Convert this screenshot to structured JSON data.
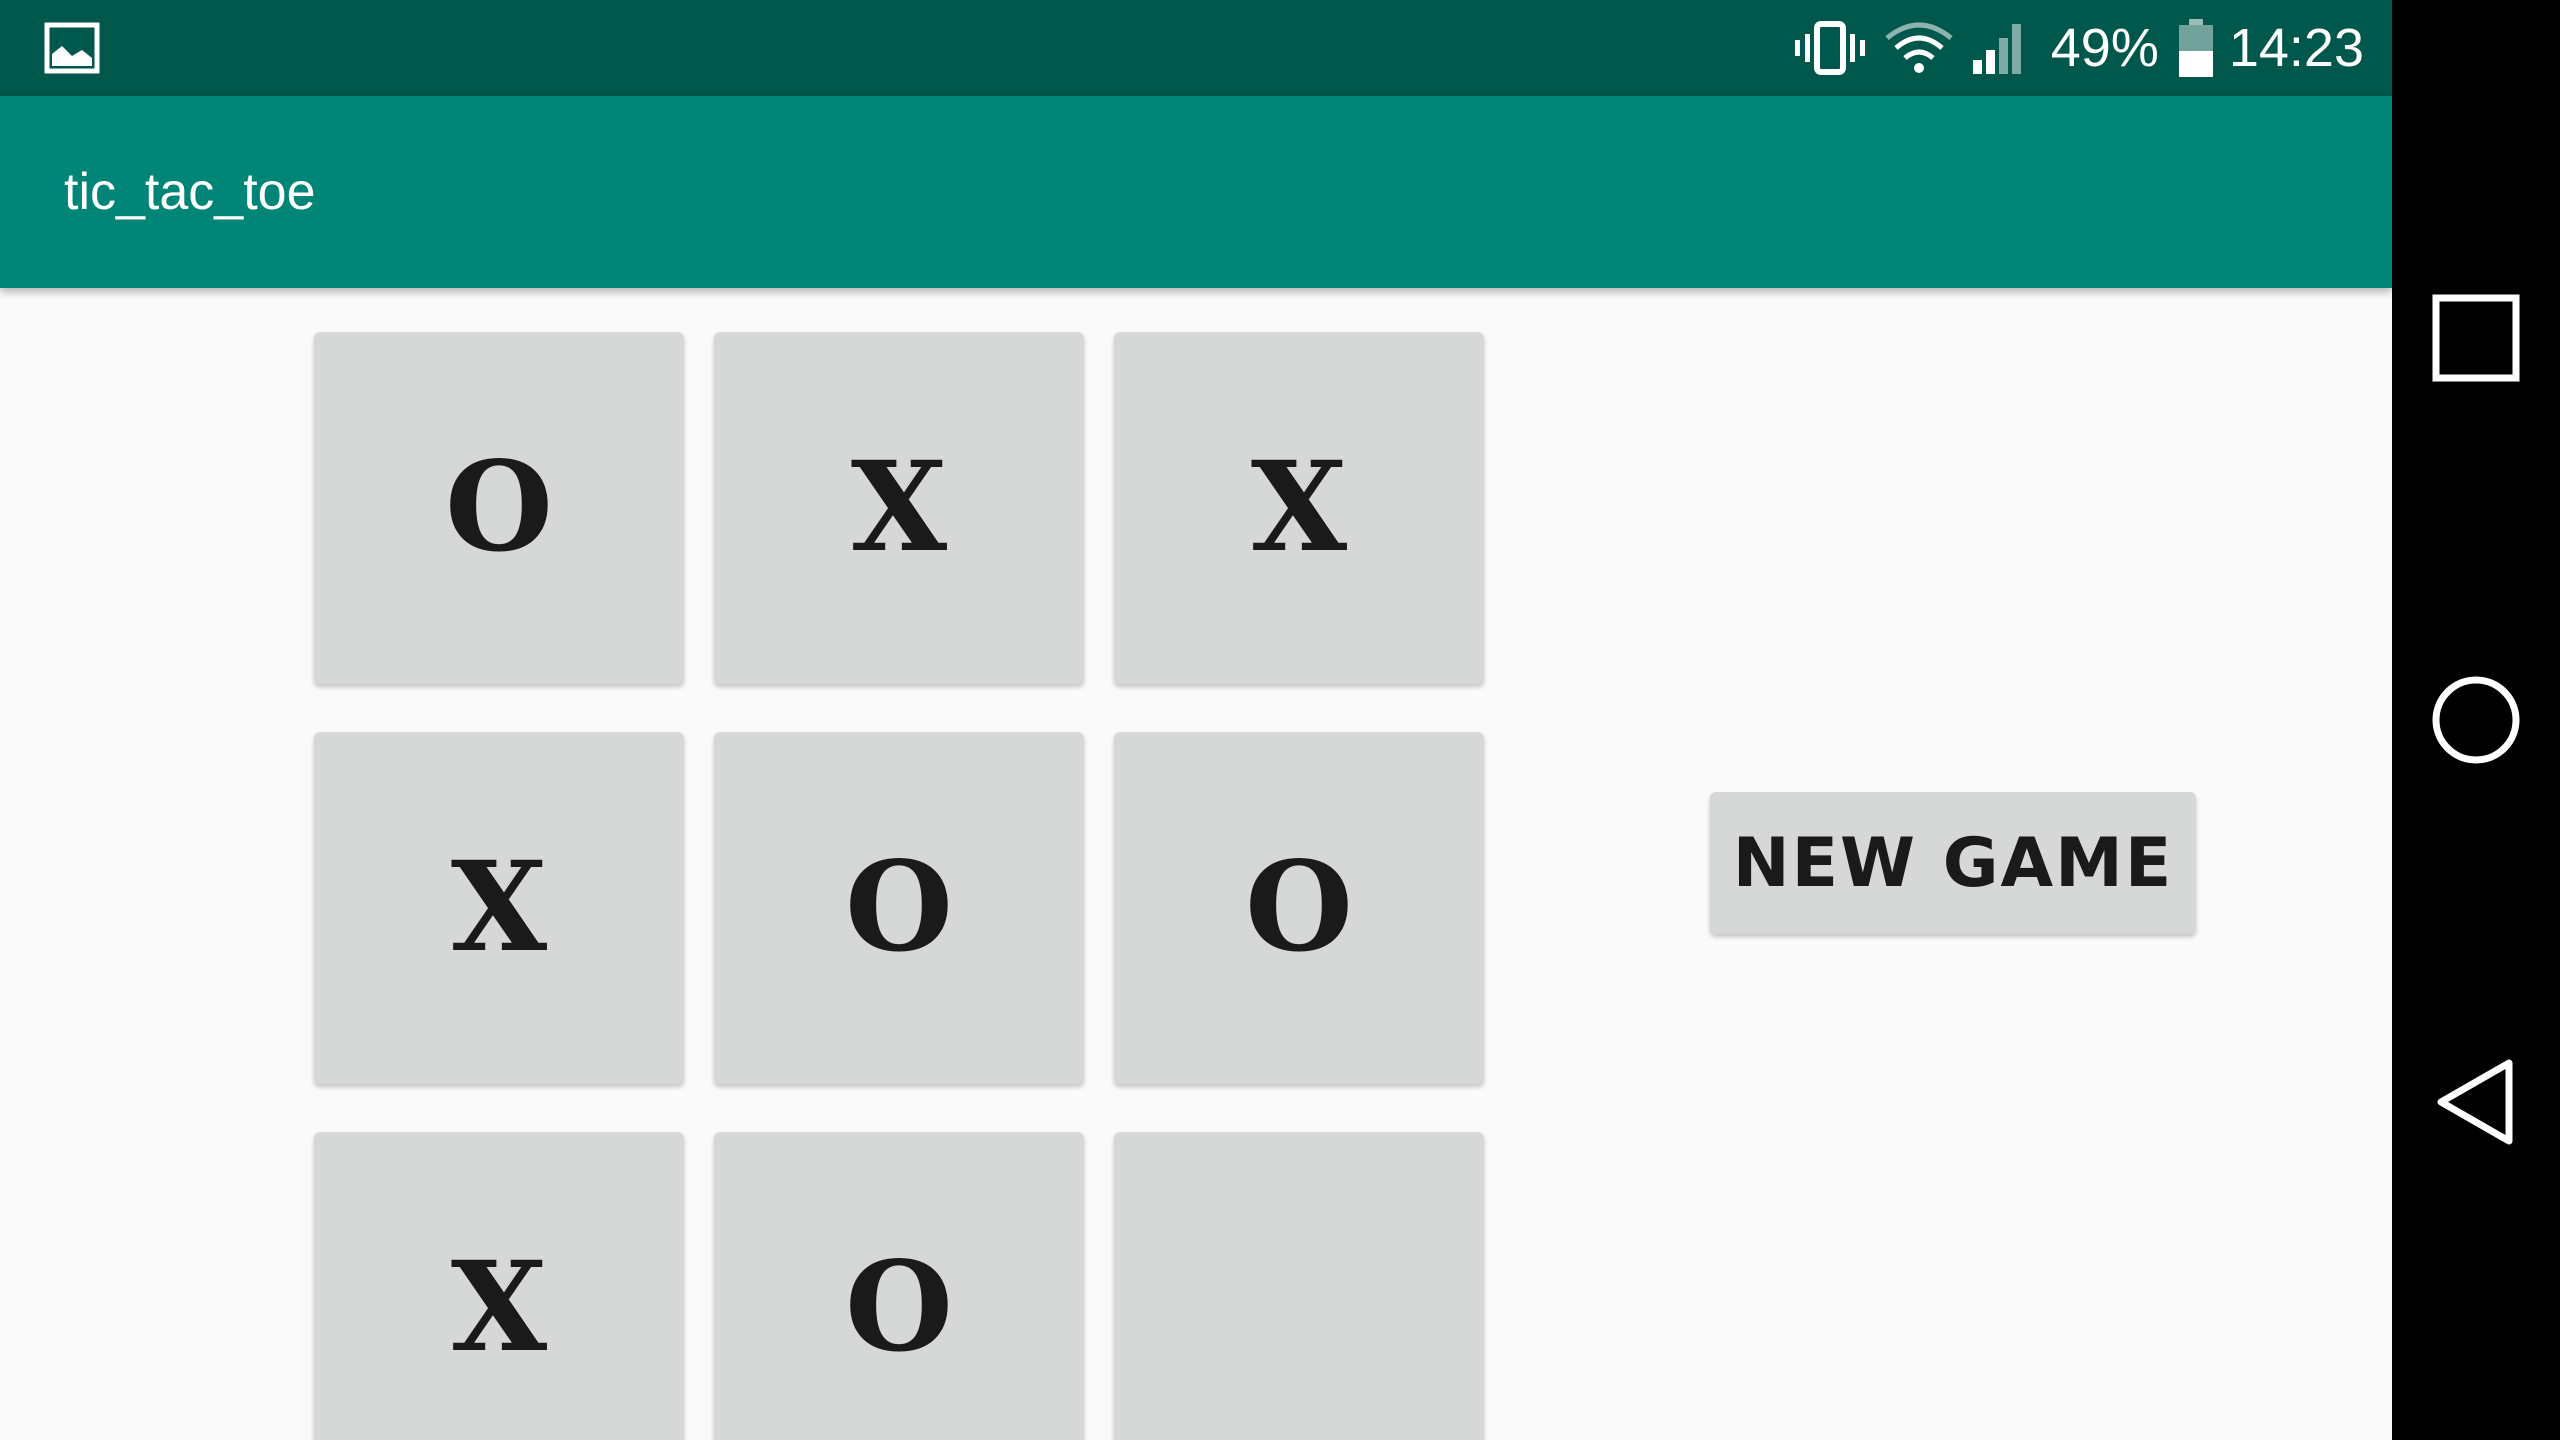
{
  "status_bar": {
    "notification_icon": "image-icon",
    "vibrate_icon": "vibrate-icon",
    "wifi_icon": "wifi-icon",
    "signal_icon": "signal-icon",
    "battery_percent": "49%",
    "battery_icon": "battery-icon",
    "time": "14:23"
  },
  "app_bar": {
    "title": "tic_tac_toe"
  },
  "board": {
    "cells": [
      {
        "value": "O"
      },
      {
        "value": "X"
      },
      {
        "value": "X"
      },
      {
        "value": "X"
      },
      {
        "value": "O"
      },
      {
        "value": "O"
      },
      {
        "value": "X"
      },
      {
        "value": "O"
      },
      {
        "value": ""
      }
    ]
  },
  "new_game": {
    "label": "NEW GAME"
  },
  "nav_bar": {
    "recents_icon": "square-recents-icon",
    "home_icon": "circle-home-icon",
    "back_icon": "triangle-back-icon"
  },
  "colors": {
    "status_bar": "#00574b",
    "app_bar": "#008577",
    "background": "#fafafa",
    "cell": "#d6d7d7",
    "nav_bar": "#000000"
  }
}
